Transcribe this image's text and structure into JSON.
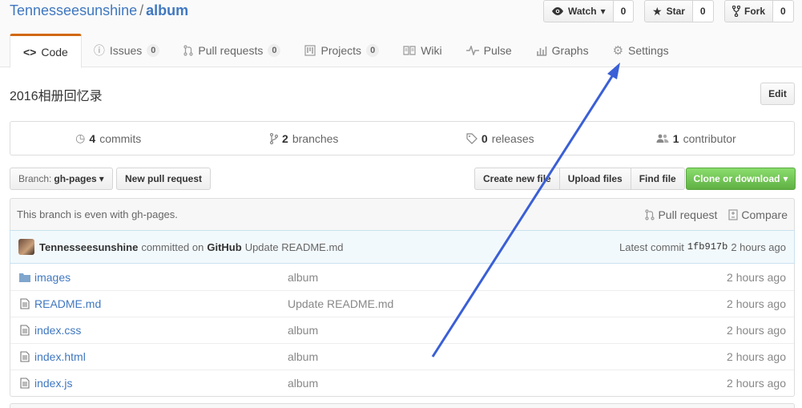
{
  "repo": {
    "owner": "Tennesseesunshine",
    "separator": "/",
    "name": "album"
  },
  "actions": [
    {
      "id": "watch",
      "label": "Watch",
      "icon": "eye-icon",
      "count": "0",
      "caret": "▾"
    },
    {
      "id": "star",
      "label": "Star",
      "icon": "star-icon",
      "count": "0"
    },
    {
      "id": "fork",
      "label": "Fork",
      "icon": "fork-icon",
      "count": "0"
    }
  ],
  "tabs": [
    {
      "label": "Code",
      "icon": "code-icon",
      "selected": true
    },
    {
      "label": "Issues",
      "icon": "issue-icon",
      "count": "0"
    },
    {
      "label": "Pull requests",
      "icon": "pull-request-icon",
      "count": "0"
    },
    {
      "label": "Projects",
      "icon": "project-icon",
      "count": "0"
    },
    {
      "label": "Wiki",
      "icon": "book-icon"
    },
    {
      "label": "Pulse",
      "icon": "pulse-icon"
    },
    {
      "label": "Graphs",
      "icon": "graph-icon"
    },
    {
      "label": "Settings",
      "icon": "gear-icon"
    }
  ],
  "description": "2016相册回忆录",
  "edit_label": "Edit",
  "summary": {
    "commits": {
      "num": "4",
      "label": "commits"
    },
    "branches": {
      "num": "2",
      "label": "branches"
    },
    "releases": {
      "num": "0",
      "label": "releases"
    },
    "contributors": {
      "num": "1",
      "label": "contributor"
    }
  },
  "branch": {
    "prefix": "Branch:",
    "name": "gh-pages",
    "caret": "▾"
  },
  "new_pr_label": "New pull request",
  "file_buttons": {
    "create": "Create new file",
    "upload": "Upload files",
    "find": "Find file"
  },
  "clone_label": "Clone or download",
  "clone_caret": "▾",
  "branch_status": {
    "text": "This branch is even with gh-pages.",
    "pull_request": "Pull request",
    "compare": "Compare"
  },
  "commit": {
    "author": "Tennesseesunshine",
    "committed_on": "committed on",
    "via": "GitHub",
    "message": "Update README.md",
    "latest_label": "Latest commit",
    "sha": "1fb917b",
    "age": "2 hours ago"
  },
  "files": [
    {
      "type": "dir",
      "icon": "folder-icon",
      "name": "images",
      "message": "album",
      "age": "2 hours ago"
    },
    {
      "type": "file",
      "icon": "file-icon",
      "name": "README.md",
      "message": "Update README.md",
      "age": "2 hours ago"
    },
    {
      "type": "file",
      "icon": "file-icon",
      "name": "index.css",
      "message": "album",
      "age": "2 hours ago"
    },
    {
      "type": "file",
      "icon": "file-icon",
      "name": "index.html",
      "message": "album",
      "age": "2 hours ago"
    },
    {
      "type": "file",
      "icon": "file-icon",
      "name": "index.js",
      "message": "album",
      "age": "2 hours ago"
    }
  ],
  "colors": {
    "link": "#4078c0",
    "tab_accent": "#d26911",
    "clone_green": "#60b044",
    "annotation_arrow": "#3a5fd6"
  }
}
